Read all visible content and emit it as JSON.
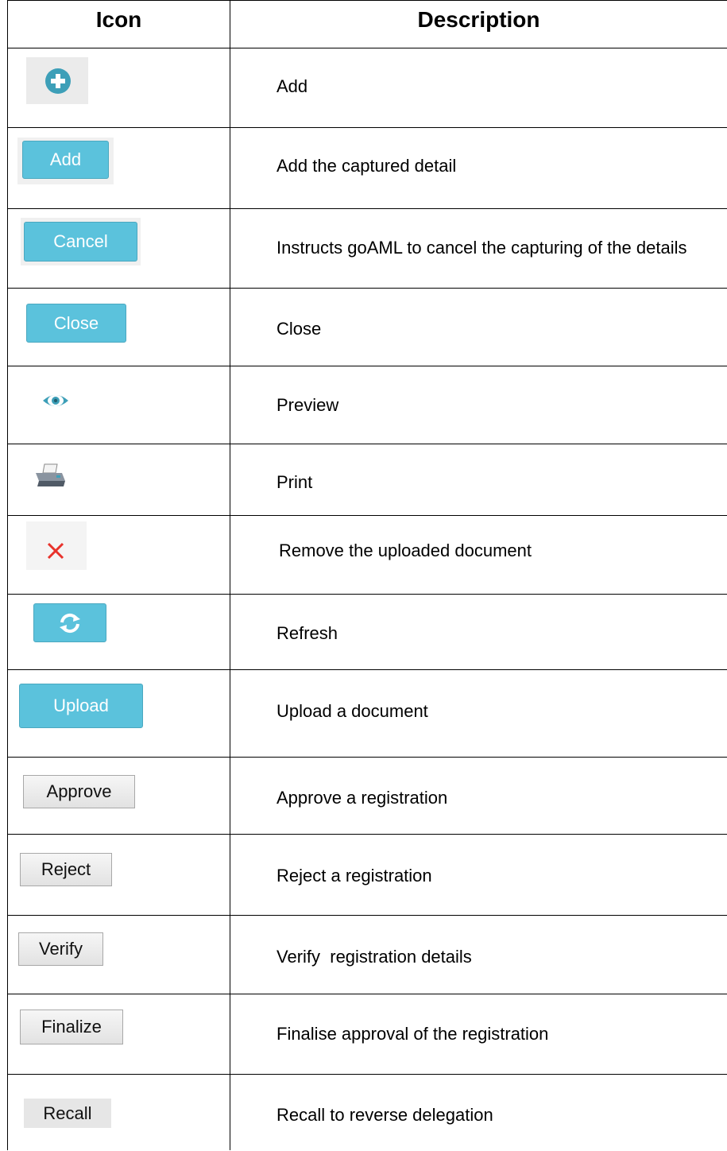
{
  "header": {
    "icon_col": "Icon",
    "desc_col": "Description"
  },
  "rows": [
    {
      "icon": "plus-circle-icon",
      "label": "",
      "description": "Add"
    },
    {
      "icon": "add-button",
      "label": "Add",
      "description": "Add the captured detail"
    },
    {
      "icon": "cancel-button",
      "label": "Cancel",
      "description": "Instructs goAML to cancel the capturing of the details"
    },
    {
      "icon": "close-button",
      "label": "Close",
      "description": "Close"
    },
    {
      "icon": "eye-icon",
      "label": "",
      "description": "Preview"
    },
    {
      "icon": "printer-icon",
      "label": "",
      "description": "Print"
    },
    {
      "icon": "close-x-icon",
      "label": "",
      "description": "Remove the uploaded document"
    },
    {
      "icon": "refresh-icon",
      "label": "",
      "description": "Refresh"
    },
    {
      "icon": "upload-button",
      "label": "Upload",
      "description": "Upload a document"
    },
    {
      "icon": "approve-button",
      "label": "Approve",
      "description": "Approve a registration"
    },
    {
      "icon": "reject-button",
      "label": "Reject",
      "description": "Reject a registration"
    },
    {
      "icon": "verify-button",
      "label": "Verify",
      "description": "Verify  registration details"
    },
    {
      "icon": "finalize-button",
      "label": "Finalize",
      "description": "Finalise approval of the registration"
    },
    {
      "icon": "recall-button",
      "label": "Recall",
      "description": "Recall to reverse delegation"
    }
  ],
  "colors": {
    "teal": "#5bc2dc",
    "icon_teal": "#3d9fb8",
    "red": "#e8322b"
  }
}
